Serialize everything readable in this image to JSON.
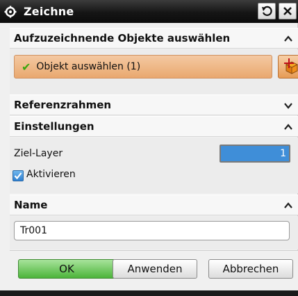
{
  "title": "Zeichne",
  "sections": {
    "objects": {
      "header": "Aufzuzeichnende Objekte auswählen",
      "select_label": "Objekt auswählen (1)"
    },
    "reference": {
      "header": "Referenzrahmen"
    },
    "settings": {
      "header": "Einstellungen",
      "layer_label": "Ziel-Layer",
      "layer_value": "1",
      "activate_label": "Aktivieren",
      "activate_checked": true
    },
    "name": {
      "header": "Name",
      "value": "Tr001"
    }
  },
  "buttons": {
    "ok": "OK",
    "apply": "Anwenden",
    "cancel": "Abbrechen"
  },
  "colors": {
    "select_highlight": "#e9a86f",
    "ok_button": "#4cb43a",
    "selected_value": "#3f8ed8"
  },
  "icons": {
    "title": "gear-icon",
    "reset": "reset-icon",
    "close": "close-icon",
    "select_check": "check-icon",
    "pick_object": "select-object-icon",
    "expanded": "chevron-up-icon",
    "collapsed": "chevron-down-icon"
  }
}
